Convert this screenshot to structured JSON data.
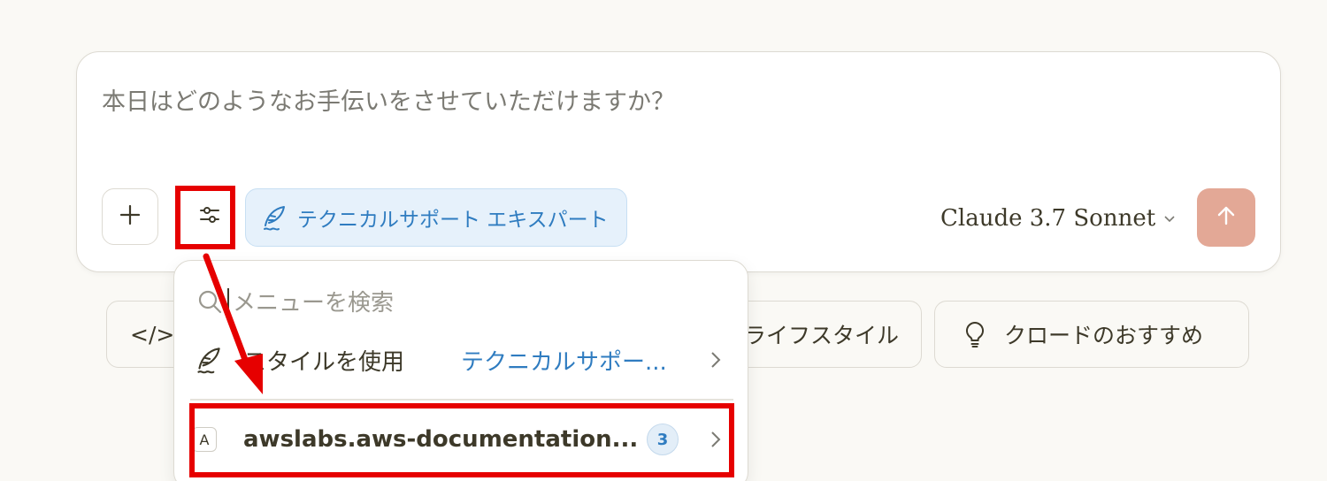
{
  "composer": {
    "placeholder": "本日はどのようなお手伝いをさせていただけますか？",
    "plus_icon": "plus-icon",
    "tools_icon": "sliders-icon",
    "style_chip": {
      "icon": "quill-icon",
      "label": "テクニカルサポート エキスパート"
    },
    "model": {
      "label": "Claude 3.7 Sonnet",
      "icon": "chevron-down-icon"
    },
    "send_icon": "arrow-up-icon",
    "send_color": "#e3a896"
  },
  "suggestions": {
    "code": {
      "icon": "code-icon",
      "label": "</>"
    },
    "life": {
      "label": "ライフスタイル"
    },
    "recommend": {
      "icon": "lightbulb-icon",
      "label": "クロードのおすすめ"
    }
  },
  "menu": {
    "search_placeholder": "メニューを検索",
    "style_row": {
      "icon": "quill-icon",
      "label": "スタイルを使用",
      "value": "テクニカルサポー..."
    },
    "mcp_row": {
      "badge": "A",
      "label": "awslabs.aws-documentation...",
      "count": "3"
    }
  },
  "annotation_color": "#e60000"
}
